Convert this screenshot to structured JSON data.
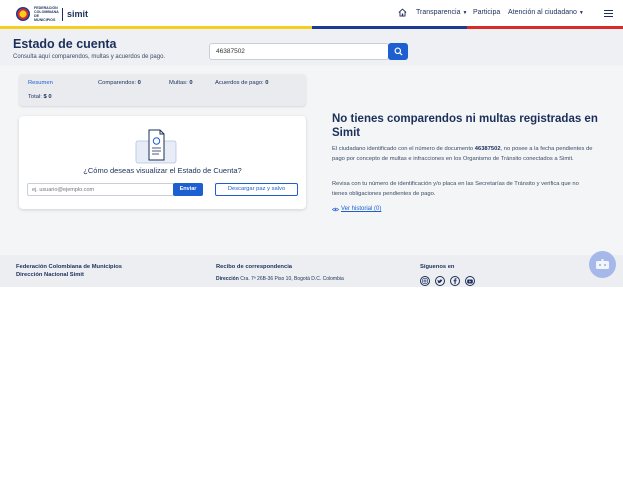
{
  "header": {
    "logo": {
      "org_name": "FEDERACIÓN COLOMBIANA DE MUNICIPIOS",
      "brand": "simit"
    },
    "nav": {
      "home_icon": "home-icon",
      "items": [
        "Transparencia",
        "Participa",
        "Atención al ciudadano"
      ],
      "menu_icon": "hamburger-menu-icon"
    },
    "flag_colors": [
      "#f5cf1e",
      "#1c3c93",
      "#d62b2b"
    ]
  },
  "page": {
    "title": "Estado de cuenta",
    "subtitle": "Consulta aquí comparendos, multas y acuerdos de pago.",
    "search": {
      "value": "46387502",
      "button_icon": "search-icon"
    }
  },
  "summary": {
    "label": "Resumen",
    "comparendos_label": "Comparendos:",
    "comparendos_value": "0",
    "multas_label": "Multas:",
    "multas_value": "0",
    "acuerdos_label": "Acuerdos de pago:",
    "acuerdos_value": "0",
    "total_label": "Total:",
    "total_value": "$ 0"
  },
  "visualize": {
    "icon": "certificate-document-icon",
    "question": "¿Cómo deseas visualizar el Estado de Cuenta?",
    "email_placeholder": "ej. usuario@ejemplo.com",
    "send_label": "Enviar",
    "download_label": "Descargar paz y salvo"
  },
  "result": {
    "title": "No tienes comparendos ni multas registradas en Simit",
    "p1_prefix": "El ciudadano identificado con el número de documento ",
    "p1_doc": "46387502",
    "p1_suffix": ", no posee a la fecha pendientes de pago por concepto de multas e infracciones en los Organismo de Tránsito conectados a Simit.",
    "p2": "Revisa con tu número de identificación y/o placa en las Secretarías de Tránsito y verifica que no tienes obligaciones pendientes de pago.",
    "history_link": "Ver historial (0)",
    "history_icon": "eye-icon"
  },
  "footer": {
    "org_line1": "Federación Colombiana de Municipios",
    "org_line2": "Dirección Nacional Simit",
    "recibo_title": "Recibo de correspondencia",
    "direccion_label": "Dirección",
    "direccion_value": "Cra. 7ª 26B-36 Piso 10, Bogotá D.C. Colombia",
    "follow_label": "Síguenos en",
    "social_icons": [
      "instagram-icon",
      "twitter-icon",
      "facebook-icon",
      "youtube-icon"
    ],
    "chat_icon": "chat-bot-icon"
  }
}
